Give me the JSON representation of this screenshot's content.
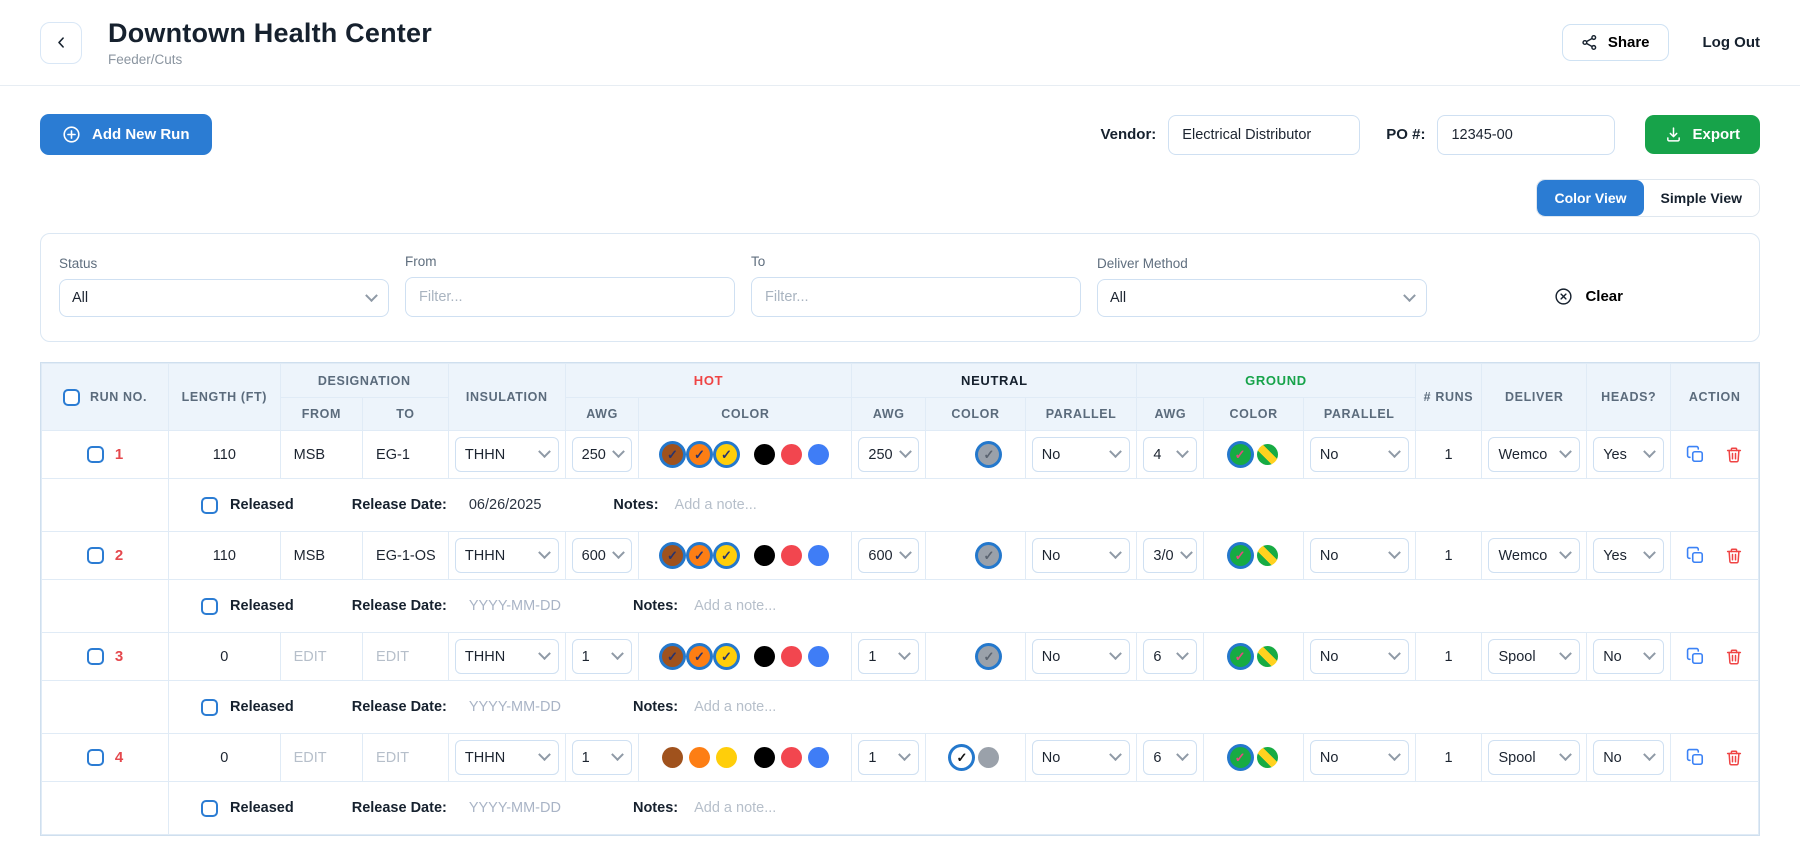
{
  "header": {
    "title": "Downtown Health Center",
    "subtitle": "Feeder/Cuts",
    "share_label": "Share",
    "logout_label": "Log Out"
  },
  "toolbar": {
    "add_new_run_label": "Add New Run",
    "vendor_label": "Vendor:",
    "vendor_value": "Electrical Distributor",
    "po_label": "PO #:",
    "po_value": "12345-00",
    "export_label": "Export"
  },
  "view_toggle": {
    "color_label": "Color View",
    "simple_label": "Simple View",
    "active": "Color View"
  },
  "filters": {
    "status_label": "Status",
    "status_value": "All",
    "from_label": "From",
    "from_placeholder": "Filter...",
    "to_label": "To",
    "to_placeholder": "Filter...",
    "deliver_label": "Deliver Method",
    "deliver_value": "All",
    "clear_label": "Clear"
  },
  "accent_colors": {
    "primary_blue": "#2b7cd3",
    "export_green": "#17a34a",
    "hot_header_red": "#ef4444",
    "ground_header_green": "#17a34a",
    "run_number_red": "#e5484d",
    "selected_ring_blue": "#2478cc"
  },
  "table": {
    "headers": {
      "run_no": "RUN NO.",
      "length": "LENGTH (FT)",
      "designation": "DESIGNATION",
      "from": "FROM",
      "to": "TO",
      "insulation": "INSULATION",
      "hot": "HOT",
      "neutral": "NEUTRAL",
      "ground": "GROUND",
      "awg": "AWG",
      "color": "COLOR",
      "parallel": "PARALLEL",
      "runs": "# RUNS",
      "deliver": "DELIVER",
      "heads": "HEADS?",
      "action": "ACTION"
    },
    "released_label": "Released",
    "release_date_label": "Release Date:",
    "notes_label": "Notes:",
    "notes_placeholder": "Add a note...",
    "swatches": {
      "brown": {
        "fill": "#a0521d",
        "check": "#27336e"
      },
      "orange": {
        "fill": "#fd7e14",
        "check": "#27336e"
      },
      "yellow": {
        "fill": "#ffce0a",
        "check": "#27336e"
      },
      "black": {
        "fill": "#000000",
        "check": "#ffffff"
      },
      "red": {
        "fill": "#f2464f",
        "check": "#ffffff"
      },
      "blue": {
        "fill": "#3f7df6",
        "check": "#ffffff"
      },
      "white": {
        "fill": "#ffffff",
        "check": "#111111"
      },
      "gray": {
        "fill": "#9aa1aa",
        "check": "#5b6470"
      },
      "green": {
        "fill": "#17ab43",
        "check": "#e84a7f"
      },
      "green-yellow": {
        "fill": "#17ab43",
        "stripe": "#ffd21f"
      }
    },
    "options": {
      "hot_groups": [
        [
          "brown",
          "orange",
          "yellow"
        ],
        [
          "black",
          "red",
          "blue"
        ]
      ],
      "neutral": [
        "white",
        "gray"
      ],
      "ground": [
        "green",
        "green-yellow"
      ]
    },
    "rows": [
      {
        "run_no": "1",
        "length": "110",
        "from": "MSB",
        "to": "EG-1",
        "designation_is_placeholder": false,
        "insulation": "THHN",
        "hot_awg": "250",
        "hot_selected": [
          "brown",
          "orange",
          "yellow"
        ],
        "neutral_awg": "250",
        "neutral_selected": [
          "gray"
        ],
        "neutral_parallel": "No",
        "ground_awg": "4",
        "ground_selected": [
          "green"
        ],
        "ground_parallel": "No",
        "num_runs": "1",
        "deliver": "Wemco",
        "heads": "Yes",
        "release_date": "06/26/2025",
        "release_date_is_placeholder": false
      },
      {
        "run_no": "2",
        "length": "110",
        "from": "MSB",
        "to": "EG-1-OS",
        "designation_is_placeholder": false,
        "insulation": "THHN",
        "hot_awg": "600",
        "hot_selected": [
          "brown",
          "orange",
          "yellow"
        ],
        "neutral_awg": "600",
        "neutral_selected": [
          "gray"
        ],
        "neutral_parallel": "No",
        "ground_awg": "3/0",
        "ground_selected": [
          "green"
        ],
        "ground_parallel": "No",
        "num_runs": "1",
        "deliver": "Wemco",
        "heads": "Yes",
        "release_date": "YYYY-MM-DD",
        "release_date_is_placeholder": true
      },
      {
        "run_no": "3",
        "length": "0",
        "from": "EDIT",
        "to": "EDIT",
        "designation_is_placeholder": true,
        "insulation": "THHN",
        "hot_awg": "1",
        "hot_selected": [
          "brown",
          "orange",
          "yellow"
        ],
        "neutral_awg": "1",
        "neutral_selected": [
          "gray"
        ],
        "neutral_parallel": "No",
        "ground_awg": "6",
        "ground_selected": [
          "green"
        ],
        "ground_parallel": "No",
        "num_runs": "1",
        "deliver": "Spool",
        "heads": "No",
        "release_date": "YYYY-MM-DD",
        "release_date_is_placeholder": true
      },
      {
        "run_no": "4",
        "length": "0",
        "from": "EDIT",
        "to": "EDIT",
        "designation_is_placeholder": true,
        "insulation": "THHN",
        "hot_awg": "1",
        "hot_selected": [],
        "neutral_awg": "1",
        "neutral_selected": [
          "white"
        ],
        "neutral_parallel": "No",
        "ground_awg": "6",
        "ground_selected": [
          "green"
        ],
        "ground_parallel": "No",
        "num_runs": "1",
        "deliver": "Spool",
        "heads": "No",
        "release_date": "YYYY-MM-DD",
        "release_date_is_placeholder": true
      }
    ]
  }
}
